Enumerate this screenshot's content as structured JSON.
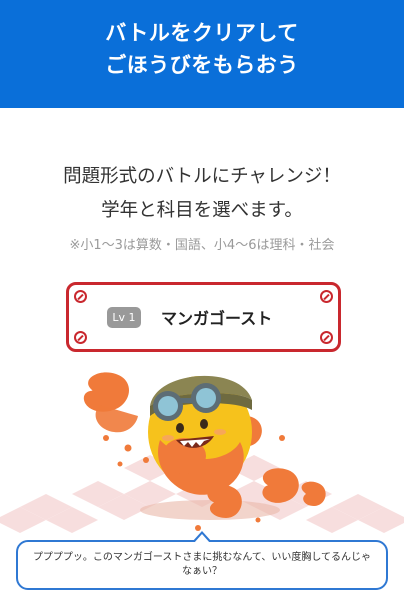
{
  "header": {
    "line1": "バトルをクリアして",
    "line2": "ごほうびをもらおう"
  },
  "intro": {
    "line1": "問題形式のバトルにチャレンジ！",
    "line2": "学年と科目を選べます。",
    "note": "※小1〜3は算数・国語、小4〜6は理科・社会"
  },
  "enemy": {
    "level": "Lv 1",
    "name": "マンガゴースト"
  },
  "speech": {
    "text": "ププププッ。このマンガゴーストさまに挑むなんて、いい度胸してるんじゃなぁい？"
  },
  "colors": {
    "header_bg": "#0a6fd9",
    "card_border": "#c9282e",
    "speech_border": "#2f78d3",
    "ghost_orange": "#f07a3a",
    "ghost_yellow": "#f6c21c"
  }
}
